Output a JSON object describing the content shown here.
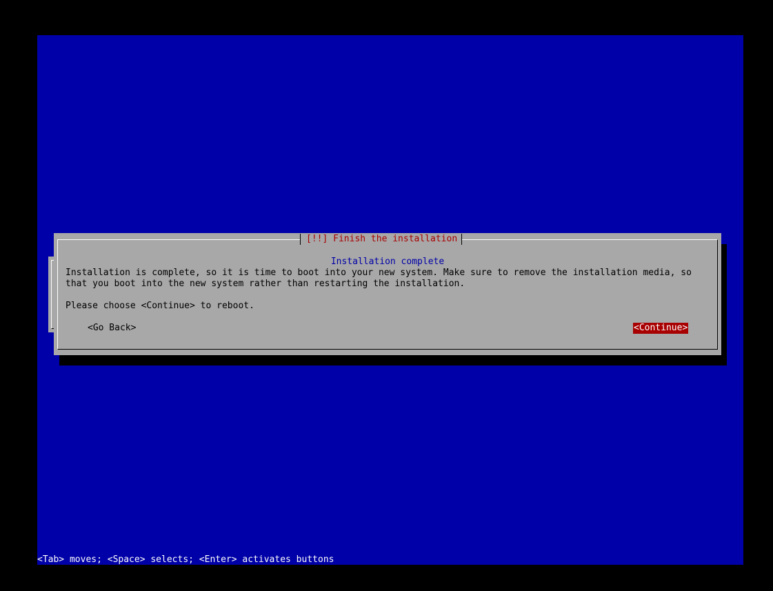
{
  "dialog": {
    "title": "[!!] Finish the installation",
    "subtitle": "Installation complete",
    "message_line1": "Installation is complete, so it is time to boot into your new system. Make sure to remove the installation media, so",
    "message_line2": "that you boot into the new system rather than restarting the installation.",
    "prompt": "Please choose <Continue> to reboot.",
    "back_label": "<Go Back>",
    "continue_label": "<Continue>"
  },
  "footer": {
    "help_text": "<Tab> moves; <Space> selects; <Enter> activates buttons"
  },
  "colors": {
    "screen_background": "#0000a8",
    "dialog_background": "#a8a8a8",
    "title_color": "#a80000",
    "subtitle_color": "#0000a8",
    "selected_button_bg": "#a80000"
  }
}
